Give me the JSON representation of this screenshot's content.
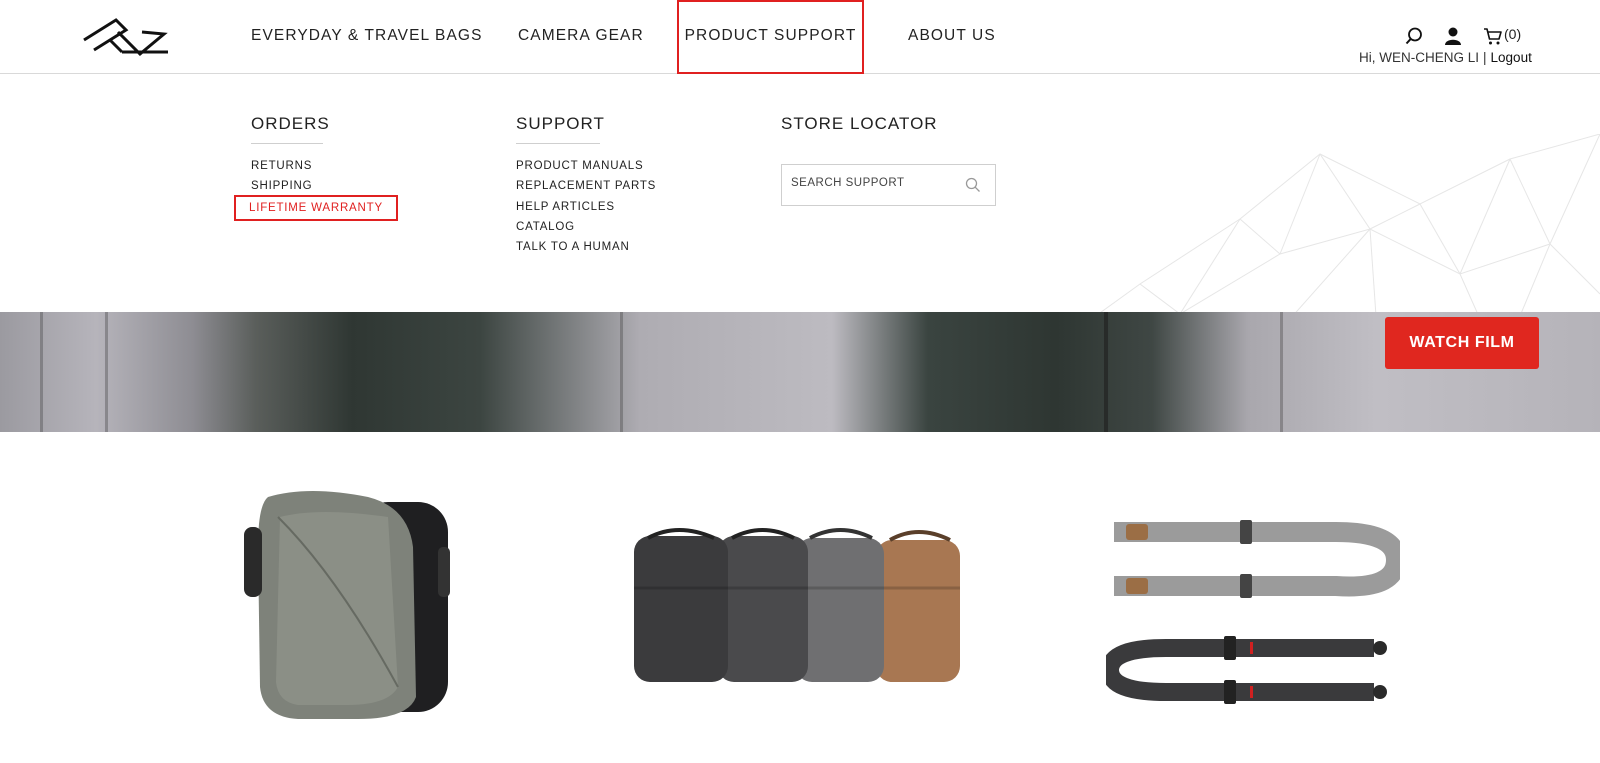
{
  "brand": {
    "logo_icon": "peak-design-logo"
  },
  "nav": {
    "items": [
      {
        "label": "EVERYDAY & TRAVEL BAGS"
      },
      {
        "label": "CAMERA GEAR"
      },
      {
        "label": "PRODUCT SUPPORT",
        "highlighted": true
      },
      {
        "label": "ABOUT US"
      }
    ]
  },
  "utility": {
    "search_icon": "search-icon",
    "account_icon": "user-icon",
    "cart_icon": "cart-icon",
    "cart_count": "(0)",
    "greeting": "Hi, WEN-CHENG LI",
    "separator": "|",
    "logout_label": "Logout"
  },
  "menu": {
    "orders": {
      "title": "ORDERS",
      "links": [
        "RETURNS",
        "SHIPPING",
        "LIFETIME WARRANTY"
      ],
      "active_link": "LIFETIME WARRANTY"
    },
    "support": {
      "title": "SUPPORT",
      "links": [
        "PRODUCT MANUALS",
        "REPLACEMENT PARTS",
        "HELP ARTICLES",
        "CATALOG",
        "TALK TO A HUMAN"
      ]
    },
    "store_locator": {
      "title": "STORE LOCATOR",
      "search_placeholder": "SEARCH SUPPORT"
    }
  },
  "banner": {
    "button_label": "WATCH FILM",
    "button_color": "#e0271f"
  },
  "products": [
    {
      "name": "travel backpack"
    },
    {
      "name": "everyday backpack"
    },
    {
      "name": "camera strap"
    }
  ],
  "colors": {
    "accent": "#e02020",
    "text": "#1a1a1a"
  }
}
